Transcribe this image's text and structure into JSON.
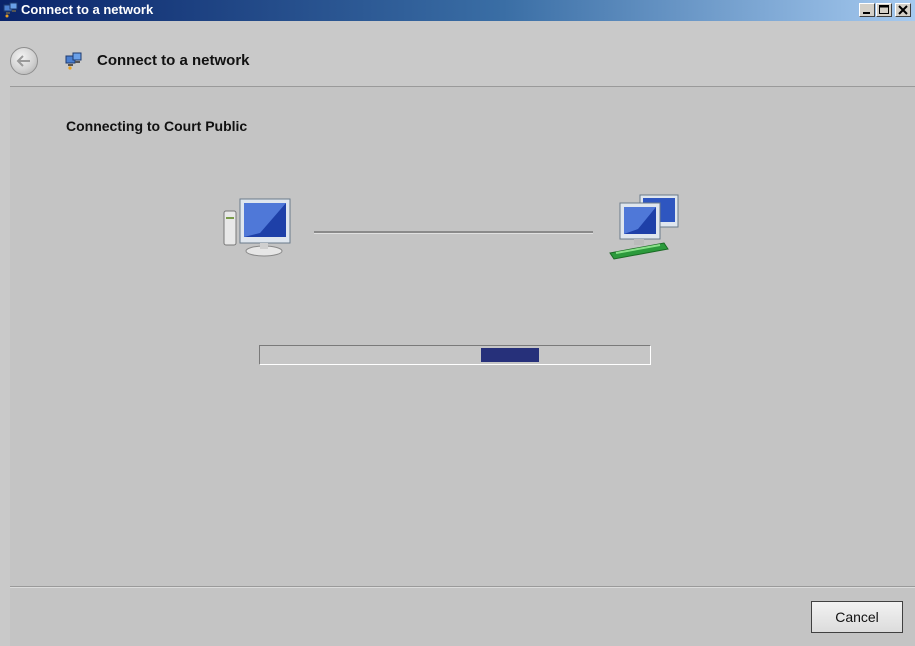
{
  "window": {
    "title": "Connect to a network",
    "controls": {
      "minimize": "minimize-icon",
      "maximize": "maximize-icon",
      "close": "close-icon"
    }
  },
  "header": {
    "back_icon": "back-arrow-icon",
    "title": "Connect to a network"
  },
  "main": {
    "status_text": "Connecting to Court Public",
    "left_icon": "computer-icon",
    "right_icon": "network-icon",
    "progress": {
      "type": "marquee",
      "color": "#26307a"
    }
  },
  "footer": {
    "cancel_label": "Cancel"
  },
  "colors": {
    "titlebar_start": "#0a246a",
    "titlebar_end": "#a6caf0",
    "background": "#c4c4c4"
  }
}
